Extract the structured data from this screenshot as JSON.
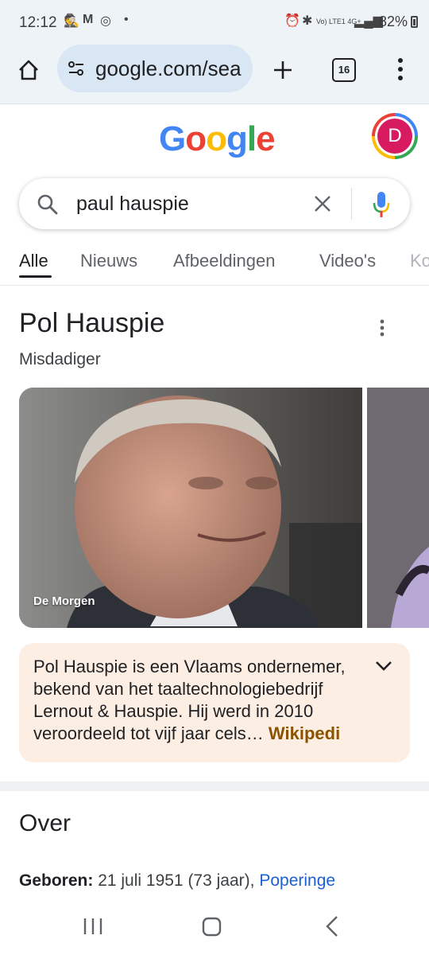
{
  "status_bar": {
    "time": "12:12",
    "network": "Vo) LTE1 4G+",
    "battery": "82%"
  },
  "browser": {
    "url": "google.com/sea",
    "tab_count": "16"
  },
  "search": {
    "query": "paul hauspie",
    "logo_text": "Google",
    "account_initial": "D"
  },
  "tabs": [
    {
      "label": "Alle",
      "active": true
    },
    {
      "label": "Nieuws"
    },
    {
      "label": "Afbeeldingen"
    },
    {
      "label": "Video's"
    },
    {
      "label": "Ko"
    }
  ],
  "entity": {
    "name": "Pol Hauspie",
    "subtitle": "Misdadiger",
    "image_source": "De Morgen",
    "description": "Pol Hauspie is een Vlaams ondernemer, bekend van het taaltechnologiebedrijf Lernout & Hauspie. Hij werd in 2010 veroordeeld tot vijf jaar cels",
    "description_ellipsis": "…",
    "description_link": "Wikipedi"
  },
  "about": {
    "heading": "Over",
    "born_label": "Geboren:",
    "born_value": "21 juli 1951 (73 jaar),",
    "born_place": "Poperinge"
  },
  "colors": {
    "google_blue": "#4285f4",
    "google_red": "#ea4335",
    "google_yellow": "#fbbc05",
    "google_green": "#34a853",
    "avatar": "#d81b60",
    "description_bg": "#fdeee3"
  }
}
